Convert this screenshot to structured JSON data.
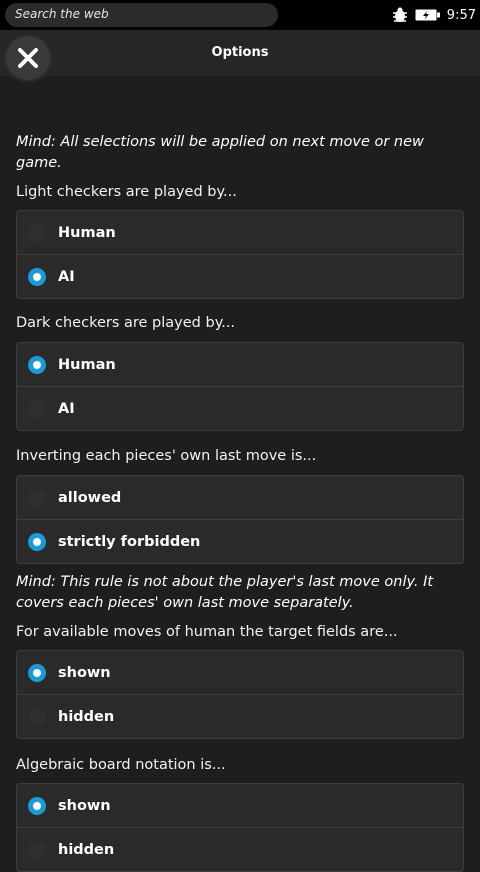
{
  "statusbar": {
    "search_placeholder": "Search the web",
    "time": "9:57",
    "icons": [
      "bug-icon",
      "battery-charging-icon"
    ]
  },
  "header": {
    "title": "Options",
    "close_icon": "close-icon"
  },
  "notes": {
    "apply_notice": "Mind: All selections will be applied on next move or new game.",
    "rule_notice": "Mind: This rule is not about the player's last move only. It covers each pieces' own last move separately."
  },
  "groups": [
    {
      "label": "Light checkers are played by...",
      "options": [
        {
          "label": "Human",
          "selected": false
        },
        {
          "label": "AI",
          "selected": true
        }
      ]
    },
    {
      "label": "Dark checkers are played by...",
      "options": [
        {
          "label": "Human",
          "selected": true
        },
        {
          "label": "AI",
          "selected": false
        }
      ]
    },
    {
      "label": "Inverting each pieces' own last move is...",
      "options": [
        {
          "label": "allowed",
          "selected": false
        },
        {
          "label": "strictly forbidden",
          "selected": true
        }
      ]
    },
    {
      "label": "For available moves of human the target fields are...",
      "options": [
        {
          "label": "shown",
          "selected": true
        },
        {
          "label": "hidden",
          "selected": false
        }
      ]
    },
    {
      "label": "Algebraic board notation is...",
      "options": [
        {
          "label": "shown",
          "selected": true
        },
        {
          "label": "hidden",
          "selected": false
        }
      ]
    }
  ],
  "colors": {
    "accent": "#1a9ad6",
    "background": "#1e1e1e",
    "group_background": "#2a2a2a"
  }
}
